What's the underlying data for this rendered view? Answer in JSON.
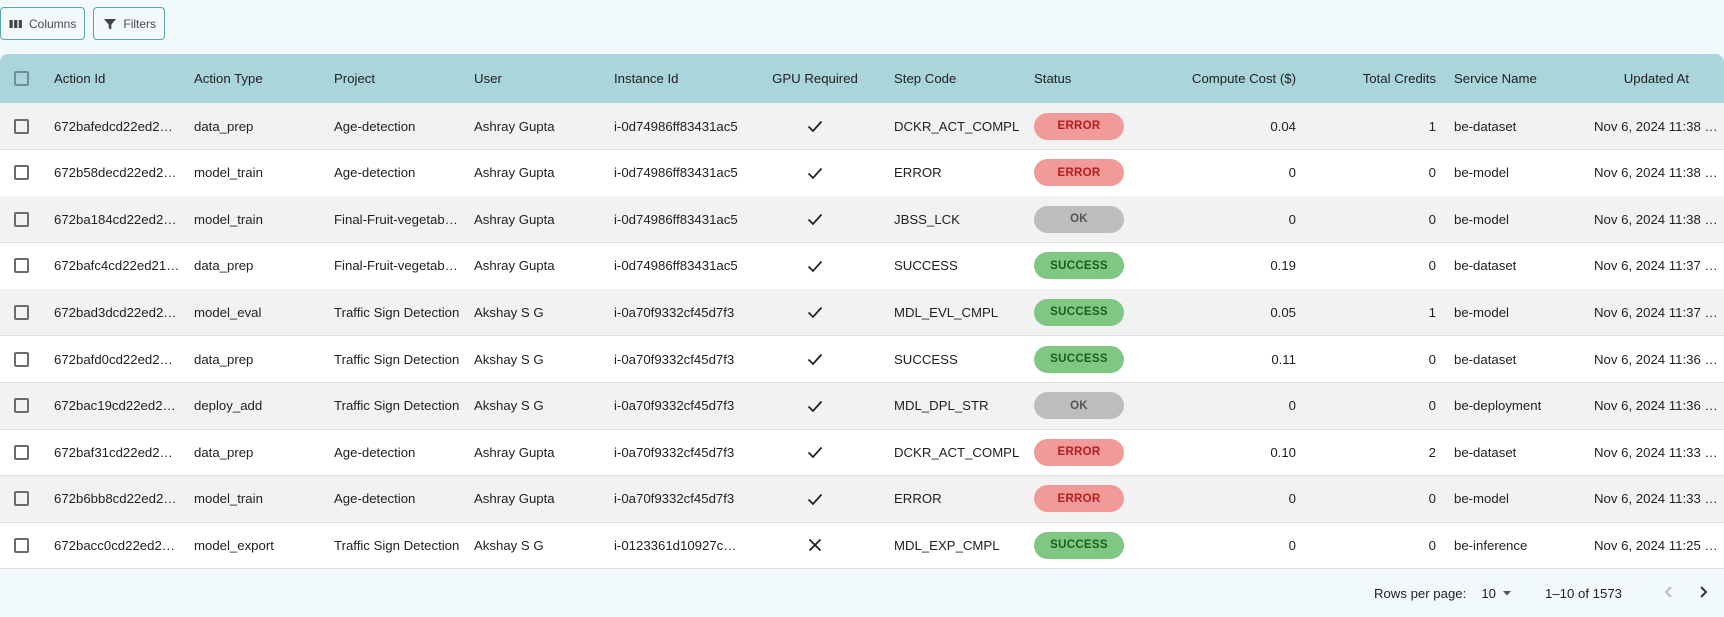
{
  "toolbar": {
    "columns_label": "Columns",
    "filters_label": "Filters"
  },
  "table": {
    "columns": [
      "Action Id",
      "Action Type",
      "Project",
      "User",
      "Instance Id",
      "GPU Required",
      "Step Code",
      "Status",
      "Compute Cost ($)",
      "Total Credits",
      "Service Name",
      "Updated At"
    ],
    "rows": [
      {
        "action_id": "672bafedcd22ed21…",
        "action_type": "data_prep",
        "project": "Age-detection",
        "user": "Ashray Gupta",
        "instance_id": "i-0d74986ff83431ac5",
        "gpu": "check",
        "step_code": "DCKR_ACT_COMPL",
        "status": "ERROR",
        "status_kind": "error",
        "compute_cost": "0.04",
        "total_credits": "1",
        "service_name": "be-dataset",
        "updated_at": "Nov 6, 2024 11:38 …"
      },
      {
        "action_id": "672b58decd22ed2…",
        "action_type": "model_train",
        "project": "Age-detection",
        "user": "Ashray Gupta",
        "instance_id": "i-0d74986ff83431ac5",
        "gpu": "check",
        "step_code": "ERROR",
        "status": "ERROR",
        "status_kind": "error",
        "compute_cost": "0",
        "total_credits": "0",
        "service_name": "be-model",
        "updated_at": "Nov 6, 2024 11:38 …"
      },
      {
        "action_id": "672ba184cd22ed2…",
        "action_type": "model_train",
        "project": "Final-Fruit-vegetab…",
        "user": "Ashray Gupta",
        "instance_id": "i-0d74986ff83431ac5",
        "gpu": "check",
        "step_code": "JBSS_LCK",
        "status": "OK",
        "status_kind": "ok",
        "compute_cost": "0",
        "total_credits": "0",
        "service_name": "be-model",
        "updated_at": "Nov 6, 2024 11:38 …"
      },
      {
        "action_id": "672bafc4cd22ed21…",
        "action_type": "data_prep",
        "project": "Final-Fruit-vegetab…",
        "user": "Ashray Gupta",
        "instance_id": "i-0d74986ff83431ac5",
        "gpu": "check",
        "step_code": "SUCCESS",
        "status": "SUCCESS",
        "status_kind": "success",
        "compute_cost": "0.19",
        "total_credits": "0",
        "service_name": "be-dataset",
        "updated_at": "Nov 6, 2024 11:37 …"
      },
      {
        "action_id": "672bad3dcd22ed2…",
        "action_type": "model_eval",
        "project": "Traffic Sign Detection",
        "user": "Akshay S G",
        "instance_id": "i-0a70f9332cf45d7f3",
        "gpu": "check",
        "step_code": "MDL_EVL_CMPL",
        "status": "SUCCESS",
        "status_kind": "success",
        "compute_cost": "0.05",
        "total_credits": "1",
        "service_name": "be-model",
        "updated_at": "Nov 6, 2024 11:37 …"
      },
      {
        "action_id": "672bafd0cd22ed21…",
        "action_type": "data_prep",
        "project": "Traffic Sign Detection",
        "user": "Akshay S G",
        "instance_id": "i-0a70f9332cf45d7f3",
        "gpu": "check",
        "step_code": "SUCCESS",
        "status": "SUCCESS",
        "status_kind": "success",
        "compute_cost": "0.11",
        "total_credits": "0",
        "service_name": "be-dataset",
        "updated_at": "Nov 6, 2024 11:36 …"
      },
      {
        "action_id": "672bac19cd22ed2…",
        "action_type": "deploy_add",
        "project": "Traffic Sign Detection",
        "user": "Akshay S G",
        "instance_id": "i-0a70f9332cf45d7f3",
        "gpu": "check",
        "step_code": "MDL_DPL_STR",
        "status": "OK",
        "status_kind": "ok",
        "compute_cost": "0",
        "total_credits": "0",
        "service_name": "be-deployment",
        "updated_at": "Nov 6, 2024 11:36 …"
      },
      {
        "action_id": "672baf31cd22ed21…",
        "action_type": "data_prep",
        "project": "Age-detection",
        "user": "Ashray Gupta",
        "instance_id": "i-0a70f9332cf45d7f3",
        "gpu": "check",
        "step_code": "DCKR_ACT_COMPL",
        "status": "ERROR",
        "status_kind": "error",
        "compute_cost": "0.10",
        "total_credits": "2",
        "service_name": "be-dataset",
        "updated_at": "Nov 6, 2024 11:33 …"
      },
      {
        "action_id": "672b6bb8cd22ed2…",
        "action_type": "model_train",
        "project": "Age-detection",
        "user": "Ashray Gupta",
        "instance_id": "i-0a70f9332cf45d7f3",
        "gpu": "check",
        "step_code": "ERROR",
        "status": "ERROR",
        "status_kind": "error",
        "compute_cost": "0",
        "total_credits": "0",
        "service_name": "be-model",
        "updated_at": "Nov 6, 2024 11:33 …"
      },
      {
        "action_id": "672bacc0cd22ed2…",
        "action_type": "model_export",
        "project": "Traffic Sign Detection",
        "user": "Akshay S G",
        "instance_id": "i-0123361d10927c…",
        "gpu": "cross",
        "step_code": "MDL_EXP_CMPL",
        "status": "SUCCESS",
        "status_kind": "success",
        "compute_cost": "0",
        "total_credits": "0",
        "service_name": "be-inference",
        "updated_at": "Nov 6, 2024 11:25 …"
      }
    ]
  },
  "pagination": {
    "rows_per_page_label": "Rows per page:",
    "rows_per_page_value": "10",
    "range_text": "1–10 of 1573"
  }
}
